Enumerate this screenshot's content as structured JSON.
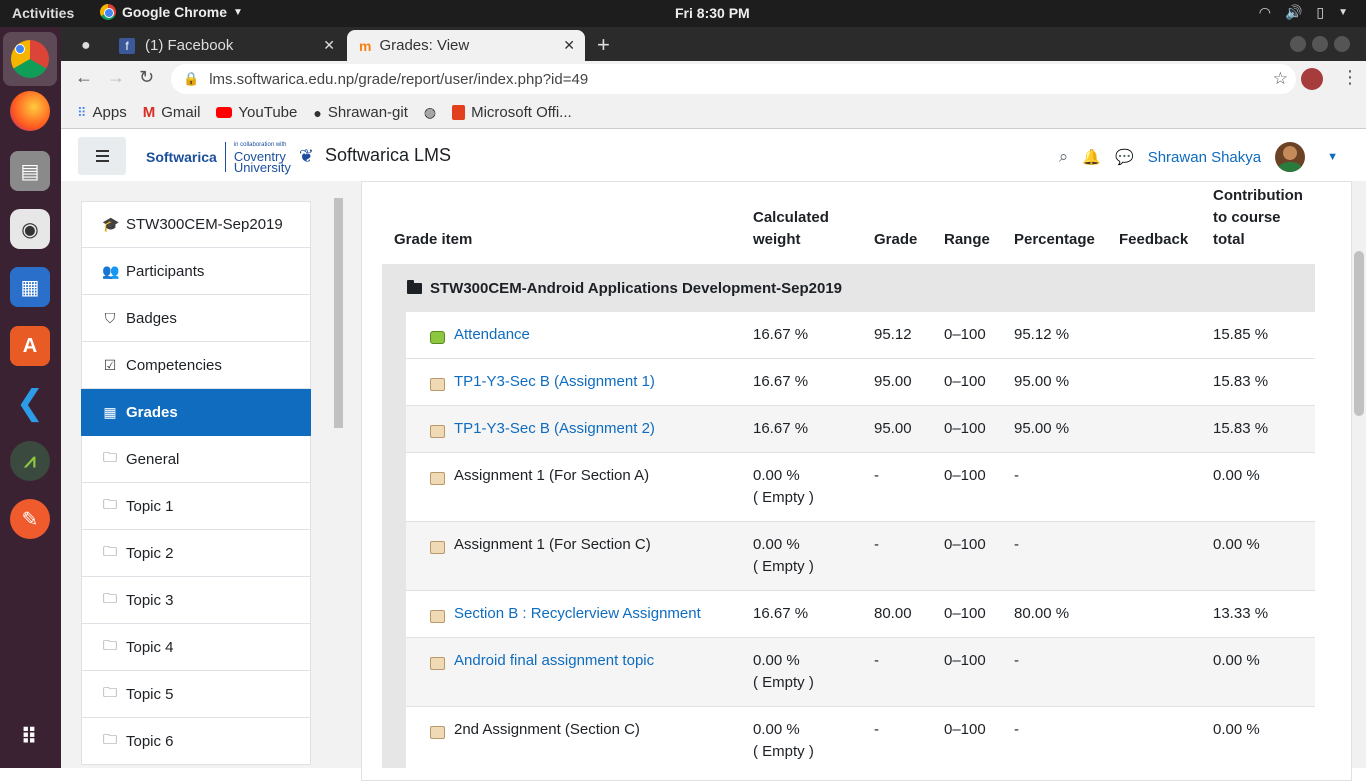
{
  "os": {
    "activities": "Activities",
    "app_name": "Google Chrome",
    "clock": "Fri  8:30 PM"
  },
  "browser": {
    "tabs": [
      {
        "label": "(1) Facebook"
      },
      {
        "label": "Grades: View"
      }
    ],
    "url": "lms.softwarica.edu.np/grade/report/user/index.php?id=49",
    "bookmarks": [
      {
        "label": "Apps"
      },
      {
        "label": "Gmail"
      },
      {
        "label": "YouTube"
      },
      {
        "label": "Shrawan-git"
      },
      {
        "label": "Microsoft Offi..."
      }
    ]
  },
  "navbar": {
    "site_name": "Softwarica LMS",
    "logo_text": "Softwarica",
    "partner_small": "in collaboration with",
    "partner_top": "Coventry",
    "partner_bottom": "University",
    "user_name": "Shrawan Shakya"
  },
  "drawer": {
    "items": [
      {
        "label": "STW300CEM-Sep2019",
        "icon": "graduation-cap"
      },
      {
        "label": "Participants",
        "icon": "users"
      },
      {
        "label": "Badges",
        "icon": "shield"
      },
      {
        "label": "Competencies",
        "icon": "check-square"
      },
      {
        "label": "Grades",
        "icon": "table",
        "active": true
      },
      {
        "label": "General",
        "icon": "folder"
      },
      {
        "label": "Topic 1",
        "icon": "folder"
      },
      {
        "label": "Topic 2",
        "icon": "folder"
      },
      {
        "label": "Topic 3",
        "icon": "folder"
      },
      {
        "label": "Topic 4",
        "icon": "folder"
      },
      {
        "label": "Topic 5",
        "icon": "folder"
      },
      {
        "label": "Topic 6",
        "icon": "folder"
      }
    ]
  },
  "grades": {
    "headers": {
      "item": "Grade item",
      "weight_1": "Calculated",
      "weight_2": "weight",
      "grade": "Grade",
      "range": "Range",
      "percentage": "Percentage",
      "feedback": "Feedback",
      "contrib_1": "Contribution",
      "contrib_2": "to course",
      "contrib_3": "total"
    },
    "category": "STW300CEM-Android Applications Development-Sep2019",
    "rows": [
      {
        "name": "Attendance",
        "link": true,
        "weight": "16.67 %",
        "weight2": "",
        "grade": "95.12",
        "range": "0–100",
        "percentage": "95.12 %",
        "contribution": "15.85 %"
      },
      {
        "name": "TP1-Y3-Sec B (Assignment 1)",
        "link": true,
        "weight": "16.67 %",
        "weight2": "",
        "grade": "95.00",
        "range": "0–100",
        "percentage": "95.00 %",
        "contribution": "15.83 %"
      },
      {
        "name": "TP1-Y3-Sec B (Assignment 2)",
        "link": true,
        "weight": "16.67 %",
        "weight2": "",
        "grade": "95.00",
        "range": "0–100",
        "percentage": "95.00 %",
        "contribution": "15.83 %"
      },
      {
        "name": "Assignment 1 (For Section A)",
        "link": false,
        "weight": "0.00 %",
        "weight2": "( Empty )",
        "grade": "-",
        "range": "0–100",
        "percentage": "-",
        "contribution": "0.00 %"
      },
      {
        "name": "Assignment 1 (For Section C)",
        "link": false,
        "weight": "0.00 %",
        "weight2": "( Empty )",
        "grade": "-",
        "range": "0–100",
        "percentage": "-",
        "contribution": "0.00 %"
      },
      {
        "name": "Section B : Recyclerview Assignment",
        "link": true,
        "weight": "16.67 %",
        "weight2": "",
        "grade": "80.00",
        "range": "0–100",
        "percentage": "80.00 %",
        "contribution": "13.33 %"
      },
      {
        "name": "Android final assignment topic",
        "link": true,
        "weight": "0.00 %",
        "weight2": "( Empty )",
        "grade": "-",
        "range": "0–100",
        "percentage": "-",
        "contribution": "0.00 %"
      },
      {
        "name": "2nd Assignment (Section C)",
        "link": false,
        "weight": "0.00 %",
        "weight2": "( Empty )",
        "grade": "-",
        "range": "0–100",
        "percentage": "-",
        "contribution": "0.00 %"
      }
    ]
  }
}
